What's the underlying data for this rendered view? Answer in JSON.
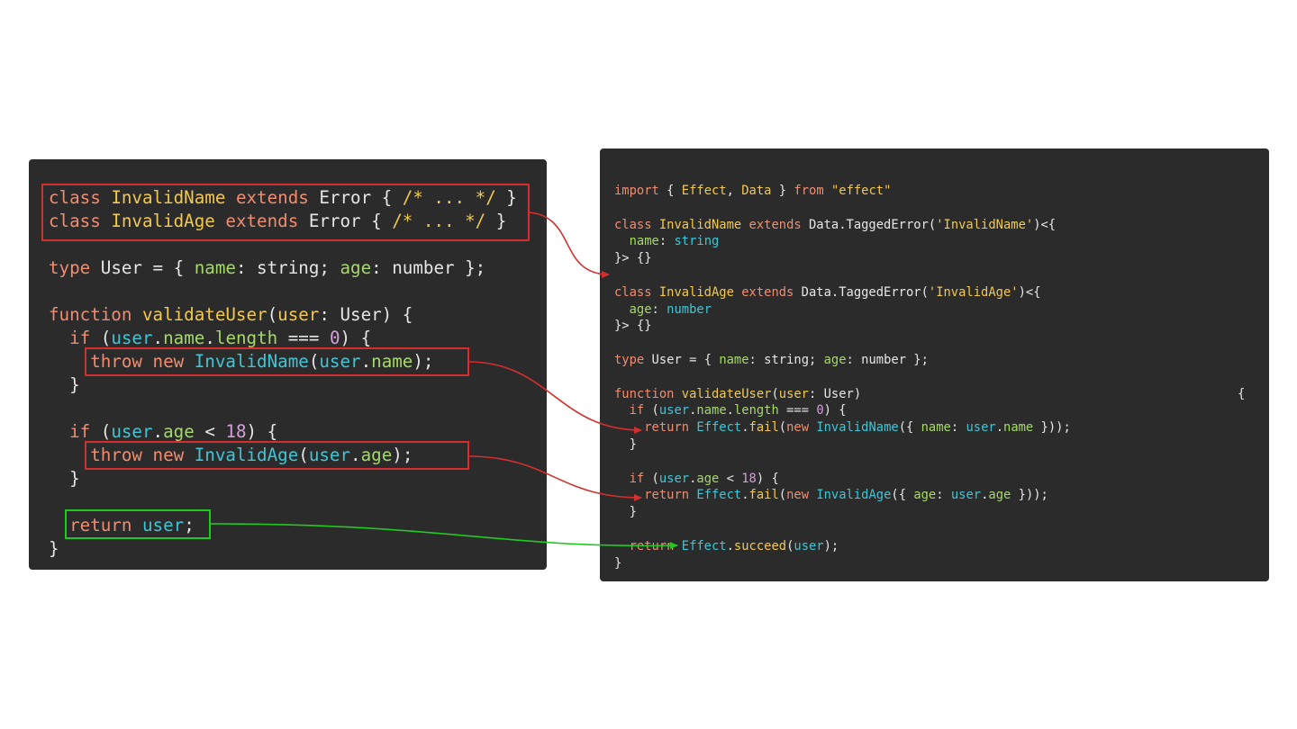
{
  "left": {
    "lines": [
      [
        [
          "kw",
          "class "
        ],
        [
          "cls",
          "InvalidName "
        ],
        [
          "kw",
          "extends "
        ],
        [
          "tv",
          "Error { "
        ],
        [
          "cmt",
          "/* ... */"
        ],
        [
          "tv",
          " }"
        ]
      ],
      [
        [
          "kw",
          "class "
        ],
        [
          "cls",
          "InvalidAge "
        ],
        [
          "kw",
          "extends "
        ],
        [
          "tv",
          "Error { "
        ],
        [
          "cmt",
          "/* ... */"
        ],
        [
          "tv",
          " }"
        ]
      ],
      [],
      [
        [
          "kw",
          "type "
        ],
        [
          "tv",
          "User = { "
        ],
        [
          "prop",
          "name"
        ],
        [
          "tv",
          ": string; "
        ],
        [
          "prop",
          "age"
        ],
        [
          "tv",
          ": number };"
        ]
      ],
      [],
      [
        [
          "kw",
          "function "
        ],
        [
          "fn",
          "validateUser"
        ],
        [
          "tv",
          "("
        ],
        [
          "cls",
          "user"
        ],
        [
          "tv",
          ": User) {"
        ]
      ],
      [
        [
          "kw",
          "  if "
        ],
        [
          "tv",
          "("
        ],
        [
          "var",
          "user"
        ],
        [
          "tv",
          "."
        ],
        [
          "prop",
          "name"
        ],
        [
          "tv",
          "."
        ],
        [
          "prop",
          "length"
        ],
        [
          "tv",
          " === "
        ],
        [
          "num",
          "0"
        ],
        [
          "tv",
          ") {"
        ]
      ],
      [
        [
          "kw",
          "    throw new "
        ],
        [
          "ecls",
          "InvalidName"
        ],
        [
          "tv",
          "("
        ],
        [
          "var",
          "user"
        ],
        [
          "tv",
          "."
        ],
        [
          "prop",
          "name"
        ],
        [
          "tv",
          ");"
        ]
      ],
      [
        [
          "tv",
          "  }"
        ]
      ],
      [],
      [
        [
          "kw",
          "  if "
        ],
        [
          "tv",
          "("
        ],
        [
          "var",
          "user"
        ],
        [
          "tv",
          "."
        ],
        [
          "prop",
          "age"
        ],
        [
          "tv",
          " < "
        ],
        [
          "num",
          "18"
        ],
        [
          "tv",
          ") {"
        ]
      ],
      [
        [
          "kw",
          "    throw new "
        ],
        [
          "ecls",
          "InvalidAge"
        ],
        [
          "tv",
          "("
        ],
        [
          "var",
          "user"
        ],
        [
          "tv",
          "."
        ],
        [
          "prop",
          "age"
        ],
        [
          "tv",
          ");"
        ]
      ],
      [
        [
          "tv",
          "  }"
        ]
      ],
      [],
      [
        [
          "kw",
          "  return "
        ],
        [
          "var",
          "user"
        ],
        [
          "tv",
          ";"
        ]
      ],
      [
        [
          "tv",
          "}"
        ]
      ]
    ]
  },
  "right": {
    "lines": [
      [
        [
          "kw",
          "import "
        ],
        [
          "tv",
          "{ "
        ],
        [
          "cls",
          "Effect"
        ],
        [
          "tv",
          ", "
        ],
        [
          "cls",
          "Data"
        ],
        [
          "tv",
          " } "
        ],
        [
          "kw",
          "from "
        ],
        [
          "str",
          "\"effect\""
        ]
      ],
      [],
      [
        [
          "kw",
          "class "
        ],
        [
          "cls",
          "InvalidName "
        ],
        [
          "kw",
          "extends "
        ],
        [
          "tv",
          "Data.TaggedError("
        ],
        [
          "str",
          "'InvalidName'"
        ],
        [
          "tv",
          ")<{"
        ]
      ],
      [
        [
          "prop",
          "  name"
        ],
        [
          "tv",
          ": "
        ],
        [
          "var",
          "string"
        ]
      ],
      [
        [
          "tv",
          "}> {}"
        ]
      ],
      [],
      [
        [
          "kw",
          "class "
        ],
        [
          "cls",
          "InvalidAge "
        ],
        [
          "kw",
          "extends "
        ],
        [
          "tv",
          "Data.TaggedError("
        ],
        [
          "str",
          "'InvalidAge'"
        ],
        [
          "tv",
          ")<{"
        ]
      ],
      [
        [
          "prop",
          "  age"
        ],
        [
          "tv",
          ": "
        ],
        [
          "var",
          "number"
        ]
      ],
      [
        [
          "tv",
          "}> {}"
        ]
      ],
      [],
      [
        [
          "kw",
          "type "
        ],
        [
          "tv",
          "User = { "
        ],
        [
          "prop",
          "name"
        ],
        [
          "tv",
          ": string; "
        ],
        [
          "prop",
          "age"
        ],
        [
          "tv",
          ": number };"
        ]
      ],
      [],
      [
        [
          "kw",
          "function "
        ],
        [
          "fn",
          "validateUser"
        ],
        [
          "tv",
          "("
        ],
        [
          "cls",
          "user"
        ],
        [
          "tv",
          ": User)"
        ]
      ],
      [
        [
          "kw",
          "  if "
        ],
        [
          "tv",
          "("
        ],
        [
          "var",
          "user"
        ],
        [
          "tv",
          "."
        ],
        [
          "prop",
          "name"
        ],
        [
          "tv",
          "."
        ],
        [
          "prop",
          "length"
        ],
        [
          "tv",
          " === "
        ],
        [
          "num",
          "0"
        ],
        [
          "tv",
          ") {"
        ]
      ],
      [
        [
          "kw",
          "    return "
        ],
        [
          "ecls",
          "Effect"
        ],
        [
          "tv",
          "."
        ],
        [
          "fn",
          "fail"
        ],
        [
          "tv",
          "("
        ],
        [
          "kw",
          "new "
        ],
        [
          "ecls",
          "InvalidName"
        ],
        [
          "tv",
          "({ "
        ],
        [
          "prop",
          "name"
        ],
        [
          "tv",
          ": "
        ],
        [
          "var",
          "user"
        ],
        [
          "tv",
          "."
        ],
        [
          "prop",
          "name"
        ],
        [
          "tv",
          " }));"
        ]
      ],
      [
        [
          "tv",
          "  }"
        ]
      ],
      [],
      [
        [
          "kw",
          "  if "
        ],
        [
          "tv",
          "("
        ],
        [
          "var",
          "user"
        ],
        [
          "tv",
          "."
        ],
        [
          "prop",
          "age"
        ],
        [
          "tv",
          " < "
        ],
        [
          "num",
          "18"
        ],
        [
          "tv",
          ") {"
        ]
      ],
      [
        [
          "kw",
          "    return "
        ],
        [
          "ecls",
          "Effect"
        ],
        [
          "tv",
          "."
        ],
        [
          "fn",
          "fail"
        ],
        [
          "tv",
          "("
        ],
        [
          "kw",
          "new "
        ],
        [
          "ecls",
          "InvalidAge"
        ],
        [
          "tv",
          "({ "
        ],
        [
          "prop",
          "age"
        ],
        [
          "tv",
          ": "
        ],
        [
          "var",
          "user"
        ],
        [
          "tv",
          "."
        ],
        [
          "prop",
          "age"
        ],
        [
          "tv",
          " }));"
        ]
      ],
      [
        [
          "tv",
          "  }"
        ]
      ],
      [],
      [
        [
          "kw",
          "  return "
        ],
        [
          "ecls",
          "Effect"
        ],
        [
          "tv",
          "."
        ],
        [
          "fn",
          "succeed"
        ],
        [
          "tv",
          "("
        ],
        [
          "var",
          "user"
        ],
        [
          "tv",
          ");"
        ]
      ],
      [
        [
          "tv",
          "}"
        ]
      ]
    ],
    "far_brace": "{"
  },
  "colors": {
    "error_box": "#d32f2f",
    "success_box": "#22c922",
    "panel_bg": "#2b2b2b"
  }
}
